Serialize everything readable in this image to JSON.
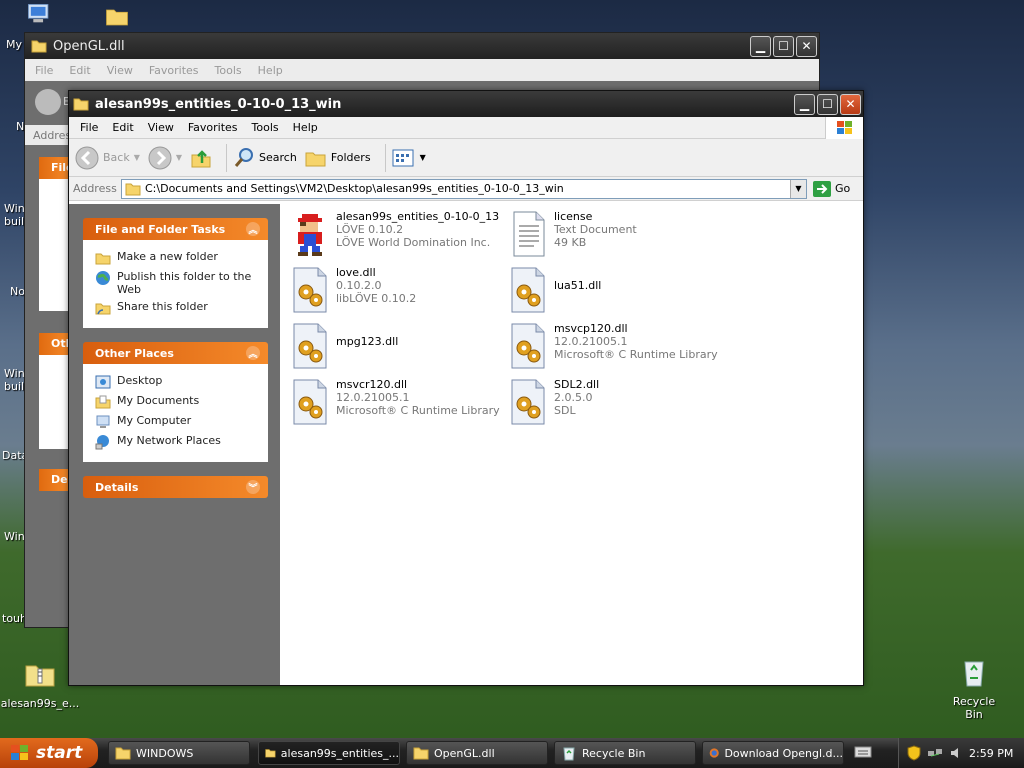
{
  "desktop": {
    "icons": [
      {
        "name": "alesan99s_e..."
      },
      {
        "name": "Recycle Bin"
      }
    ],
    "fragments": [
      "My",
      "N",
      "Win",
      "buil",
      "No",
      "Win",
      "buil",
      "Data",
      "Win",
      "touh"
    ]
  },
  "back_window": {
    "title": "OpenGL.dll",
    "menu": [
      "File",
      "Edit",
      "View",
      "Favorites",
      "Tools",
      "Help"
    ],
    "fragments": {
      "addr": "Addres",
      "e": "E",
      "panel1": "File",
      "panel2": "Oth",
      "panel3": "De"
    }
  },
  "window": {
    "title": "alesan99s_entities_0-10-0_13_win",
    "menu": [
      "File",
      "Edit",
      "View",
      "Favorites",
      "Tools",
      "Help"
    ],
    "toolbar": {
      "back": "Back",
      "search": "Search",
      "folders": "Folders"
    },
    "address": {
      "label": "Address",
      "value": "C:\\Documents and Settings\\VM2\\Desktop\\alesan99s_entities_0-10-0_13_win",
      "go": "Go"
    },
    "panels": [
      {
        "title": "File and Folder Tasks",
        "items": [
          "Make a new folder",
          "Publish this folder to the Web",
          "Share this folder"
        ]
      },
      {
        "title": "Other Places",
        "items": [
          "Desktop",
          "My Documents",
          "My Computer",
          "My Network Places"
        ]
      },
      {
        "title": "Details",
        "items": []
      }
    ],
    "files": [
      {
        "name": "alesan99s_entities_0-10-0_13",
        "line2": "LÖVE 0.10.2",
        "line3": "LÖVE World Domination Inc.",
        "icon": "mario-exe-icon"
      },
      {
        "name": "license",
        "line2": "Text Document",
        "line3": "49 KB",
        "icon": "text-document-icon"
      },
      {
        "name": "love.dll",
        "line2": "0.10.2.0",
        "line3": "libLÖVE 0.10.2",
        "icon": "dll-icon"
      },
      {
        "name": "lua51.dll",
        "line2": "",
        "line3": "",
        "icon": "dll-icon"
      },
      {
        "name": "mpg123.dll",
        "line2": "",
        "line3": "",
        "icon": "dll-icon"
      },
      {
        "name": "msvcp120.dll",
        "line2": "12.0.21005.1",
        "line3": "Microsoft® C Runtime Library",
        "icon": "dll-icon"
      },
      {
        "name": "msvcr120.dll",
        "line2": "12.0.21005.1",
        "line3": "Microsoft® C Runtime Library",
        "icon": "dll-icon"
      },
      {
        "name": "SDL2.dll",
        "line2": "2.0.5.0",
        "line3": "SDL",
        "icon": "dll-icon"
      }
    ]
  },
  "taskbar": {
    "start": "start",
    "buttons": [
      {
        "label": "WINDOWS",
        "icon": "folder-icon"
      },
      {
        "label": "alesan99s_entities_...",
        "icon": "folder-icon"
      },
      {
        "label": "OpenGL.dll",
        "icon": "folder-icon"
      },
      {
        "label": "Recycle Bin",
        "icon": "recycle-bin-icon"
      },
      {
        "label": "Download Opengl.d...",
        "icon": "browser-icon"
      }
    ],
    "clock": "2:59 PM"
  },
  "colors": {
    "accent_orange": "#e8721c",
    "titlebar": "#2a2a2a",
    "taskpane": "#6e6e6e"
  }
}
